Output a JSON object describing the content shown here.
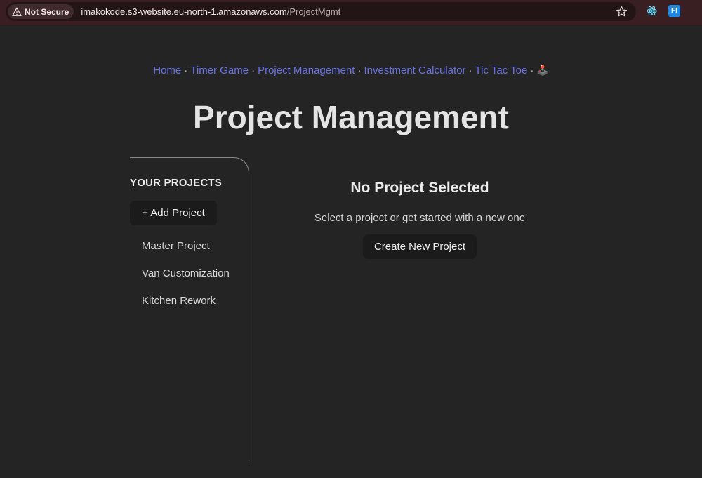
{
  "browser": {
    "security_label": "Not Secure",
    "url_host": "imakokode.s3-website.eu-north-1.amazonaws.com",
    "url_path": "/ProjectMgmt",
    "extension_fi_label": "FI"
  },
  "nav": {
    "links": [
      "Home",
      "Timer Game",
      "Project Management",
      "Investment Calculator",
      "Tic Tac Toe"
    ],
    "separator": "·",
    "trailing_emoji": "🕹️",
    "link_color": "#6a73e6"
  },
  "page": {
    "title": "Project Management"
  },
  "sidebar": {
    "heading": "YOUR PROJECTS",
    "add_button_label": "+ Add Project",
    "projects": [
      "Master Project",
      "Van Customization",
      "Kitchen Rework"
    ]
  },
  "main": {
    "empty_title": "No Project Selected",
    "empty_subtitle": "Select a project or get started with a new one",
    "create_button_label": "Create New Project"
  },
  "colors": {
    "background": "#242424",
    "browser_bar": "#3a1f22",
    "button_bg": "#1b1b1b"
  }
}
